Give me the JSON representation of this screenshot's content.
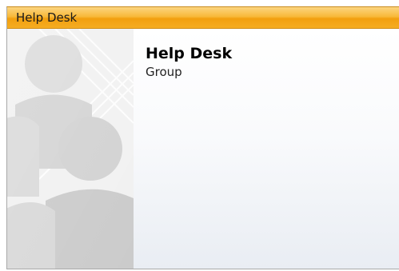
{
  "header": {
    "title": "Help Desk"
  },
  "card": {
    "name": "Help Desk",
    "type": "Group",
    "picture_icon": "group-people-icon"
  },
  "colors": {
    "header_accent": "#f8b93a",
    "picture_background": "#f0f0f0"
  }
}
